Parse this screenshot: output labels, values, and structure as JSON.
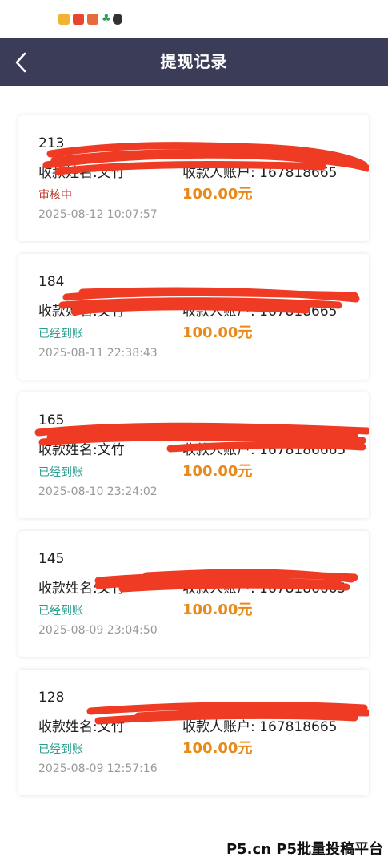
{
  "status_bar": {
    "icons": [
      "app-icon-yellow",
      "app-icon-red",
      "app-icon-orange",
      "leaf-icon",
      "qq-icon"
    ]
  },
  "header": {
    "title": "提现记录",
    "back_icon": "chevron-left-icon"
  },
  "records": [
    {
      "id": "213",
      "payee": "收款姓名:文竹",
      "account": "收款人账户: 167818665",
      "status": "审核中",
      "status_color": "#c0392b",
      "amount": "100.00元",
      "time": "2025-08-12 10:07:57"
    },
    {
      "id": "184",
      "payee": "收款姓名:文竹",
      "account": "收款人账户: 167818665",
      "status": "已经到账",
      "status_color": "#2a9d8f",
      "amount": "100.00元",
      "time": "2025-08-11 22:38:43"
    },
    {
      "id": "165",
      "payee": "收款姓名:文竹",
      "account": "收款人账户: 1678186665",
      "status": "已经到账",
      "status_color": "#2a9d8f",
      "amount": "100.00元",
      "time": "2025-08-10 23:24:02"
    },
    {
      "id": "145",
      "payee": "收款姓名:文竹",
      "account": "收款人账户: 1678186665",
      "status": "已经到账",
      "status_color": "#2a9d8f",
      "amount": "100.00元",
      "time": "2025-08-09 23:04:50"
    },
    {
      "id": "128",
      "payee": "收款姓名:文竹",
      "account": "收款人账户: 167818665",
      "status": "已经到账",
      "status_color": "#2a9d8f",
      "amount": "100.00元",
      "time": "2025-08-09 12:57:16"
    }
  ],
  "watermark": "P5.cn P5批量投稿平台",
  "colors": {
    "header_bg": "#3b3d58",
    "amount": "#e88a1a",
    "redaction": "#ef3a24"
  }
}
